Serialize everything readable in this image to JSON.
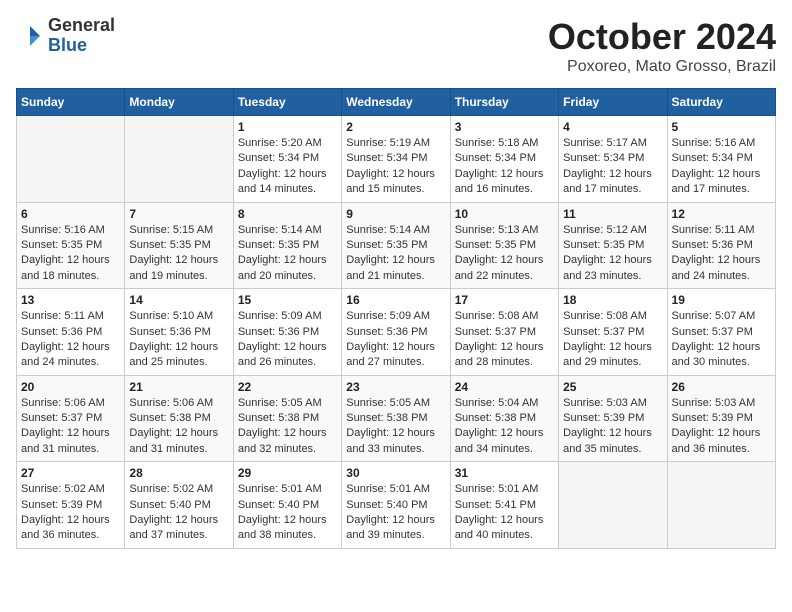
{
  "header": {
    "logo_general": "General",
    "logo_blue": "Blue",
    "month": "October 2024",
    "location": "Poxoreo, Mato Grosso, Brazil"
  },
  "days_of_week": [
    "Sunday",
    "Monday",
    "Tuesday",
    "Wednesday",
    "Thursday",
    "Friday",
    "Saturday"
  ],
  "weeks": [
    [
      {
        "day": "",
        "sunrise": "",
        "sunset": "",
        "daylight": ""
      },
      {
        "day": "",
        "sunrise": "",
        "sunset": "",
        "daylight": ""
      },
      {
        "day": "1",
        "sunrise": "Sunrise: 5:20 AM",
        "sunset": "Sunset: 5:34 PM",
        "daylight": "Daylight: 12 hours and 14 minutes."
      },
      {
        "day": "2",
        "sunrise": "Sunrise: 5:19 AM",
        "sunset": "Sunset: 5:34 PM",
        "daylight": "Daylight: 12 hours and 15 minutes."
      },
      {
        "day": "3",
        "sunrise": "Sunrise: 5:18 AM",
        "sunset": "Sunset: 5:34 PM",
        "daylight": "Daylight: 12 hours and 16 minutes."
      },
      {
        "day": "4",
        "sunrise": "Sunrise: 5:17 AM",
        "sunset": "Sunset: 5:34 PM",
        "daylight": "Daylight: 12 hours and 17 minutes."
      },
      {
        "day": "5",
        "sunrise": "Sunrise: 5:16 AM",
        "sunset": "Sunset: 5:34 PM",
        "daylight": "Daylight: 12 hours and 17 minutes."
      }
    ],
    [
      {
        "day": "6",
        "sunrise": "Sunrise: 5:16 AM",
        "sunset": "Sunset: 5:35 PM",
        "daylight": "Daylight: 12 hours and 18 minutes."
      },
      {
        "day": "7",
        "sunrise": "Sunrise: 5:15 AM",
        "sunset": "Sunset: 5:35 PM",
        "daylight": "Daylight: 12 hours and 19 minutes."
      },
      {
        "day": "8",
        "sunrise": "Sunrise: 5:14 AM",
        "sunset": "Sunset: 5:35 PM",
        "daylight": "Daylight: 12 hours and 20 minutes."
      },
      {
        "day": "9",
        "sunrise": "Sunrise: 5:14 AM",
        "sunset": "Sunset: 5:35 PM",
        "daylight": "Daylight: 12 hours and 21 minutes."
      },
      {
        "day": "10",
        "sunrise": "Sunrise: 5:13 AM",
        "sunset": "Sunset: 5:35 PM",
        "daylight": "Daylight: 12 hours and 22 minutes."
      },
      {
        "day": "11",
        "sunrise": "Sunrise: 5:12 AM",
        "sunset": "Sunset: 5:35 PM",
        "daylight": "Daylight: 12 hours and 23 minutes."
      },
      {
        "day": "12",
        "sunrise": "Sunrise: 5:11 AM",
        "sunset": "Sunset: 5:36 PM",
        "daylight": "Daylight: 12 hours and 24 minutes."
      }
    ],
    [
      {
        "day": "13",
        "sunrise": "Sunrise: 5:11 AM",
        "sunset": "Sunset: 5:36 PM",
        "daylight": "Daylight: 12 hours and 24 minutes."
      },
      {
        "day": "14",
        "sunrise": "Sunrise: 5:10 AM",
        "sunset": "Sunset: 5:36 PM",
        "daylight": "Daylight: 12 hours and 25 minutes."
      },
      {
        "day": "15",
        "sunrise": "Sunrise: 5:09 AM",
        "sunset": "Sunset: 5:36 PM",
        "daylight": "Daylight: 12 hours and 26 minutes."
      },
      {
        "day": "16",
        "sunrise": "Sunrise: 5:09 AM",
        "sunset": "Sunset: 5:36 PM",
        "daylight": "Daylight: 12 hours and 27 minutes."
      },
      {
        "day": "17",
        "sunrise": "Sunrise: 5:08 AM",
        "sunset": "Sunset: 5:37 PM",
        "daylight": "Daylight: 12 hours and 28 minutes."
      },
      {
        "day": "18",
        "sunrise": "Sunrise: 5:08 AM",
        "sunset": "Sunset: 5:37 PM",
        "daylight": "Daylight: 12 hours and 29 minutes."
      },
      {
        "day": "19",
        "sunrise": "Sunrise: 5:07 AM",
        "sunset": "Sunset: 5:37 PM",
        "daylight": "Daylight: 12 hours and 30 minutes."
      }
    ],
    [
      {
        "day": "20",
        "sunrise": "Sunrise: 5:06 AM",
        "sunset": "Sunset: 5:37 PM",
        "daylight": "Daylight: 12 hours and 31 minutes."
      },
      {
        "day": "21",
        "sunrise": "Sunrise: 5:06 AM",
        "sunset": "Sunset: 5:38 PM",
        "daylight": "Daylight: 12 hours and 31 minutes."
      },
      {
        "day": "22",
        "sunrise": "Sunrise: 5:05 AM",
        "sunset": "Sunset: 5:38 PM",
        "daylight": "Daylight: 12 hours and 32 minutes."
      },
      {
        "day": "23",
        "sunrise": "Sunrise: 5:05 AM",
        "sunset": "Sunset: 5:38 PM",
        "daylight": "Daylight: 12 hours and 33 minutes."
      },
      {
        "day": "24",
        "sunrise": "Sunrise: 5:04 AM",
        "sunset": "Sunset: 5:38 PM",
        "daylight": "Daylight: 12 hours and 34 minutes."
      },
      {
        "day": "25",
        "sunrise": "Sunrise: 5:03 AM",
        "sunset": "Sunset: 5:39 PM",
        "daylight": "Daylight: 12 hours and 35 minutes."
      },
      {
        "day": "26",
        "sunrise": "Sunrise: 5:03 AM",
        "sunset": "Sunset: 5:39 PM",
        "daylight": "Daylight: 12 hours and 36 minutes."
      }
    ],
    [
      {
        "day": "27",
        "sunrise": "Sunrise: 5:02 AM",
        "sunset": "Sunset: 5:39 PM",
        "daylight": "Daylight: 12 hours and 36 minutes."
      },
      {
        "day": "28",
        "sunrise": "Sunrise: 5:02 AM",
        "sunset": "Sunset: 5:40 PM",
        "daylight": "Daylight: 12 hours and 37 minutes."
      },
      {
        "day": "29",
        "sunrise": "Sunrise: 5:01 AM",
        "sunset": "Sunset: 5:40 PM",
        "daylight": "Daylight: 12 hours and 38 minutes."
      },
      {
        "day": "30",
        "sunrise": "Sunrise: 5:01 AM",
        "sunset": "Sunset: 5:40 PM",
        "daylight": "Daylight: 12 hours and 39 minutes."
      },
      {
        "day": "31",
        "sunrise": "Sunrise: 5:01 AM",
        "sunset": "Sunset: 5:41 PM",
        "daylight": "Daylight: 12 hours and 40 minutes."
      },
      {
        "day": "",
        "sunrise": "",
        "sunset": "",
        "daylight": ""
      },
      {
        "day": "",
        "sunrise": "",
        "sunset": "",
        "daylight": ""
      }
    ]
  ]
}
